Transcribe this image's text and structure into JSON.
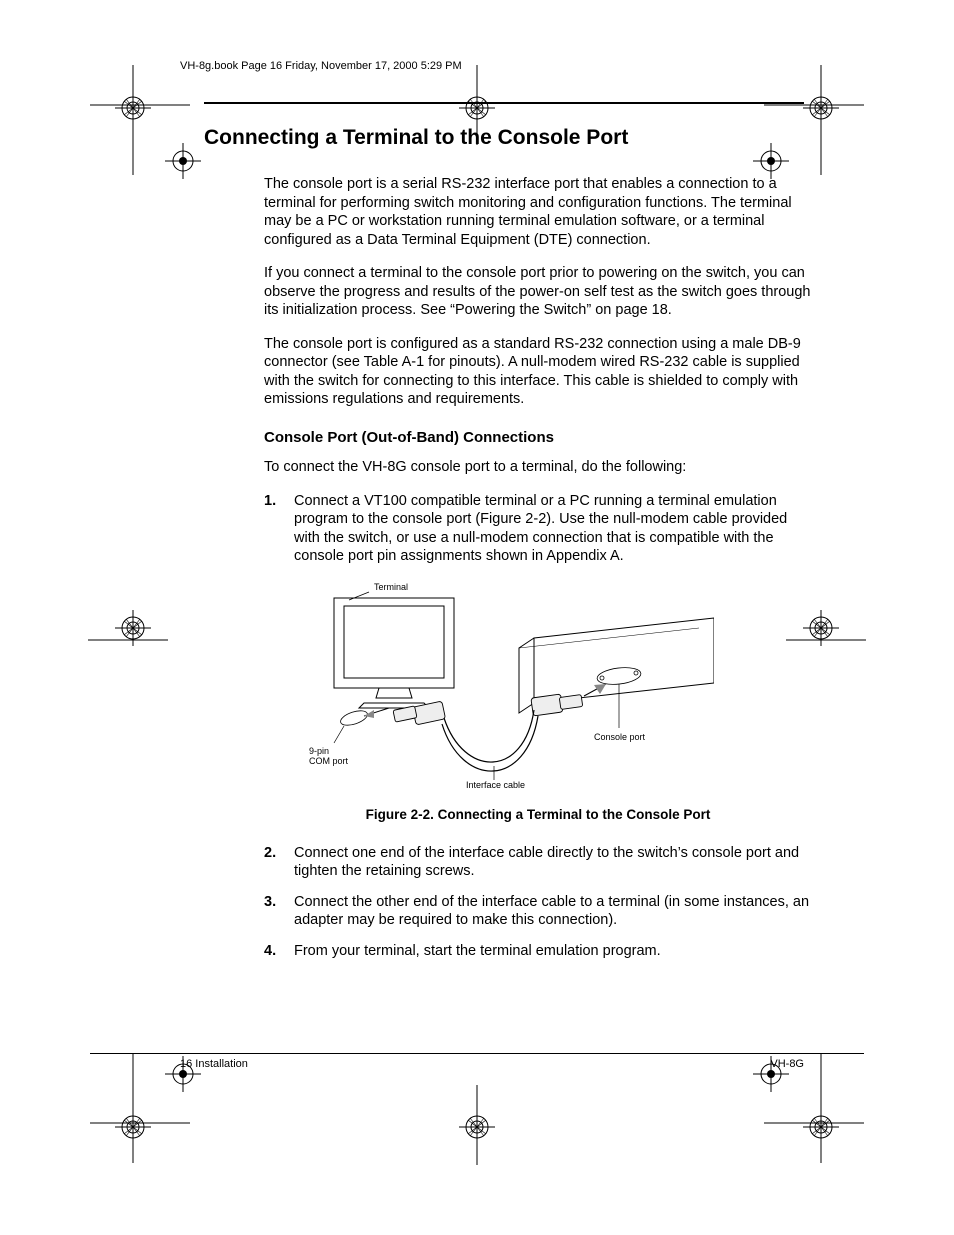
{
  "header": {
    "running": "VH-8g.book  Page 16  Friday, November 17, 2000  5:29 PM"
  },
  "title": "Connecting a Terminal to the Console Port",
  "paras": {
    "p1": "The console port is a serial RS-232 interface port that enables a connection to a terminal for performing switch monitoring and configuration functions. The terminal may be a PC or workstation running terminal emulation software, or a terminal configured as a Data Terminal Equipment (DTE) connection.",
    "p2": "If you connect a terminal to the console port prior to powering on the switch, you can observe the progress and results of the power-on self test as the switch goes through its initialization process. See “Powering the Switch” on page 18.",
    "p3": "The console port is configured as a standard RS-232 connection using a male DB-9 connector (see Table A-1 for pinouts). A null-modem wired RS-232 cable is supplied with the switch for connecting to this interface. This cable is shielded to comply with emissions regulations and requirements."
  },
  "subhead": "Console Port (Out-of-Band) Connections",
  "lead": "To connect the VH-8G console port to a terminal, do the following:",
  "steps": {
    "s1": "Connect a VT100 compatible terminal or a PC running a terminal emulation program to the console port (Figure 2-2). Use the null-modem cable provided with the switch, or use a null-modem connection that is compatible with the console port pin assignments shown in Appendix A.",
    "s2": "Connect one end of the interface cable directly to the switch’s console port and tighten the retaining screws.",
    "s3": "Connect the other end of the interface cable to a terminal (in some instances, an adapter may be required to make this connection).",
    "s4": "From your terminal, start the terminal emulation program."
  },
  "figure": {
    "caption": "Figure 2-2.  Connecting a Terminal to the Console Port",
    "labels": {
      "terminal": "Terminal",
      "comport": "9-pin\nCOM port",
      "consoleport": "Console port",
      "ifcable": "Interface cable"
    }
  },
  "footer": {
    "left": "16  Installation",
    "right": "VH-8G"
  }
}
